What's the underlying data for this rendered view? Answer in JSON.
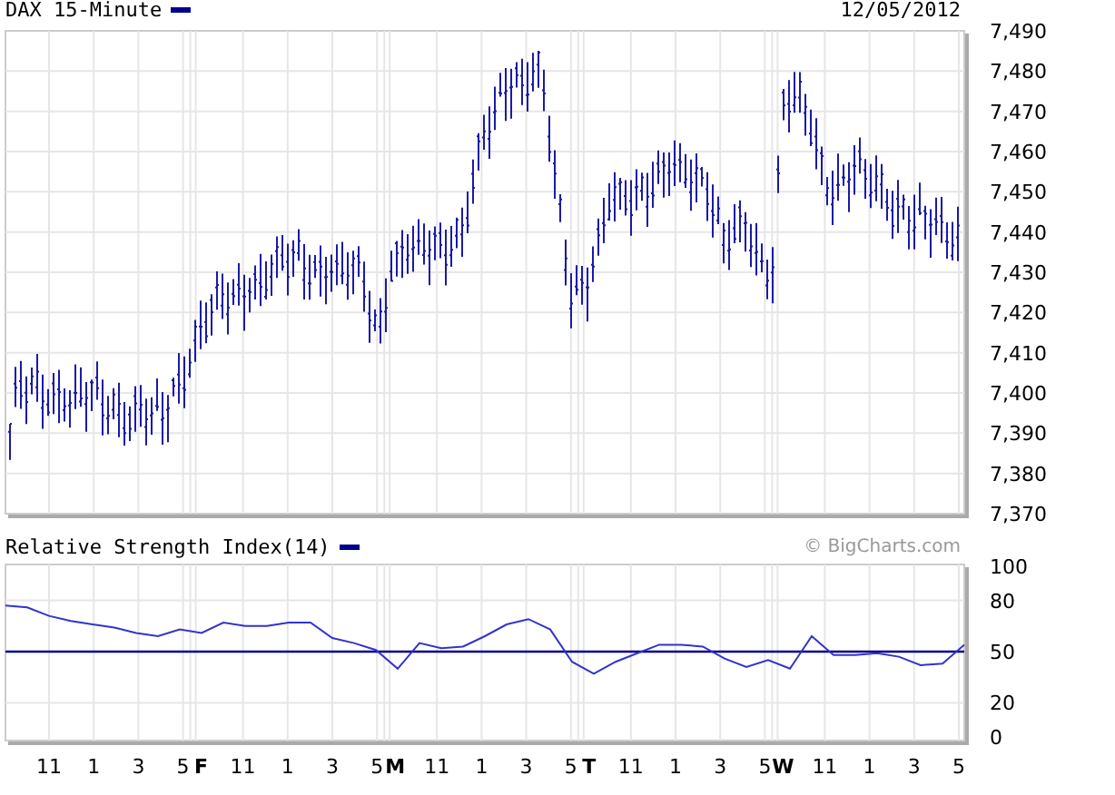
{
  "price_panel": {
    "title": "DAX 15-Minute",
    "date": "12/05/2012",
    "y_axis_labels": [
      "7,490",
      "7,480",
      "7,470",
      "7,460",
      "7,450",
      "7,440",
      "7,430",
      "7,420",
      "7,410",
      "7,400",
      "7,390",
      "7,380",
      "7,370"
    ]
  },
  "rsi_panel": {
    "title": "Relative Strength Index(14)",
    "credit": "© BigCharts.com",
    "chart_data": {
      "type": "line",
      "ylim": [
        0,
        100
      ],
      "yticks": [
        0,
        20,
        50,
        80,
        100
      ],
      "grid": true,
      "ref_lines": [
        {
          "axis": "y",
          "value": 50,
          "color": "#00008b"
        }
      ],
      "series": [
        {
          "color": "#3333cc",
          "values": [
            77,
            76,
            71,
            68,
            66,
            64,
            61,
            59,
            63,
            61,
            67,
            65,
            65,
            67,
            67,
            58,
            55,
            51,
            40,
            55,
            52,
            53,
            59,
            66,
            69,
            63,
            44,
            37,
            44,
            49,
            54,
            54,
            53,
            46,
            41,
            45,
            40,
            59,
            48,
            48,
            49,
            47,
            42,
            43,
            54
          ]
        }
      ]
    }
  },
  "x_axis": {
    "labels": [
      {
        "text": "11",
        "kind": "hour"
      },
      {
        "text": "1",
        "kind": "hour"
      },
      {
        "text": "3",
        "kind": "hour"
      },
      {
        "text": "5",
        "kind": "hour"
      },
      {
        "text": "F",
        "kind": "day"
      },
      {
        "text": "11",
        "kind": "hour"
      },
      {
        "text": "1",
        "kind": "hour"
      },
      {
        "text": "3",
        "kind": "hour"
      },
      {
        "text": "5",
        "kind": "hour"
      },
      {
        "text": "M",
        "kind": "day"
      },
      {
        "text": "11",
        "kind": "hour"
      },
      {
        "text": "1",
        "kind": "hour"
      },
      {
        "text": "3",
        "kind": "hour"
      },
      {
        "text": "5",
        "kind": "hour"
      },
      {
        "text": "T",
        "kind": "day"
      },
      {
        "text": "11",
        "kind": "hour"
      },
      {
        "text": "1",
        "kind": "hour"
      },
      {
        "text": "3",
        "kind": "hour"
      },
      {
        "text": "5",
        "kind": "hour"
      },
      {
        "text": "W",
        "kind": "day"
      },
      {
        "text": "11",
        "kind": "hour"
      },
      {
        "text": "1",
        "kind": "hour"
      },
      {
        "text": "3",
        "kind": "hour"
      },
      {
        "text": "5",
        "kind": "hour"
      }
    ]
  }
}
